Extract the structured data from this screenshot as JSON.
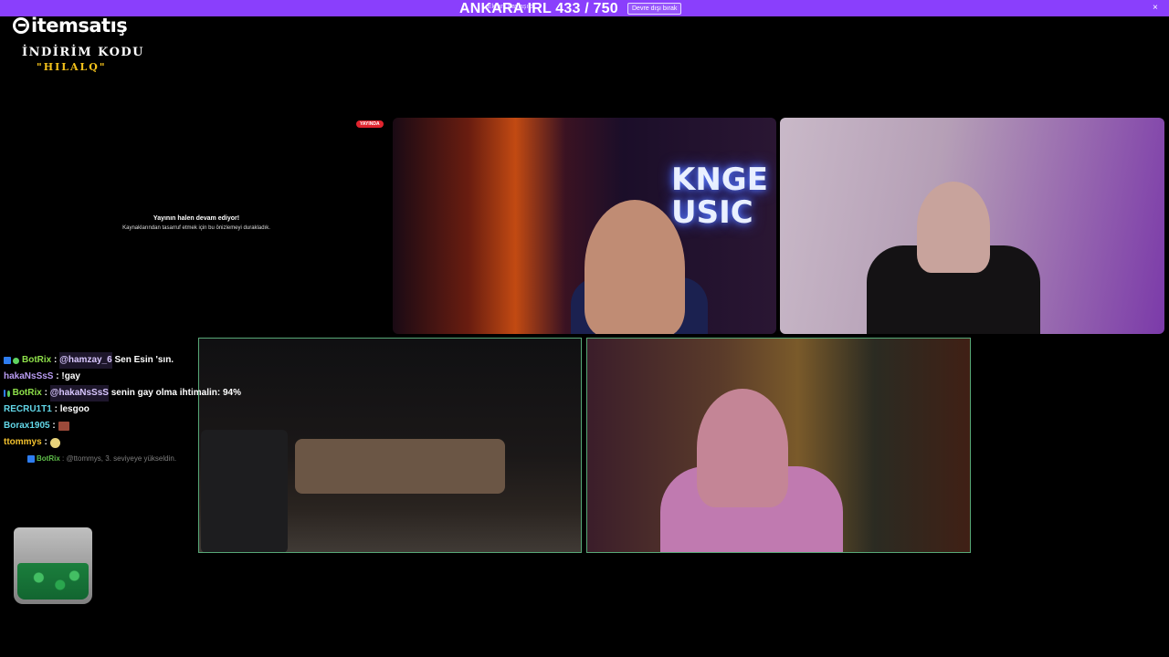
{
  "topbar": {
    "notice": "Ekranı paylaşıldı.",
    "title": "ANKARA IRL 433 / 750",
    "button": "Devre dışı bırak",
    "close": "×"
  },
  "brand": {
    "logo": "itemsatış",
    "promo_line1": "İNDİRİM KODU",
    "promo_line2": "\"HILALQ\""
  },
  "stream": {
    "live_badge": "YAYINDA",
    "paused_title": "Yayının halen devam ediyor!",
    "paused_subtitle": "Kaynaklarından tasarruf etmek için bu önizlemeyi durakladık.",
    "neon_sign": "KNGE\nUSIC"
  },
  "chat": [
    {
      "user": "BotRix",
      "mention": "@hamzay_6",
      "text": "Sen Esin 'sın.",
      "badges": true,
      "color": "green"
    },
    {
      "user": "hakaNsSsS",
      "text": "!gay",
      "badges": false,
      "color": "purple"
    },
    {
      "user": "BotRix",
      "mention": "@hakaNsSsS",
      "text": "senin gay olma ihtimalin: 94%",
      "badges": true,
      "color": "green"
    },
    {
      "user": "RECRU1T1",
      "text": "lesgoo",
      "badges": false,
      "color": "cyan"
    },
    {
      "user": "Borax1905",
      "text": "",
      "badges": false,
      "color": "cyan",
      "emote": "emote"
    },
    {
      "user": "ttommys",
      "text": "",
      "badges": false,
      "color": "yellow",
      "emote": "emote2"
    }
  ],
  "system_message": {
    "user": "BotRix",
    "text": "@ttommys, 3. seviyeye yükseldin."
  },
  "icons": [
    "close-icon",
    "logo-icon",
    "bot-badge-icon",
    "verified-dot-icon",
    "emote-icon",
    "jar-icon"
  ]
}
